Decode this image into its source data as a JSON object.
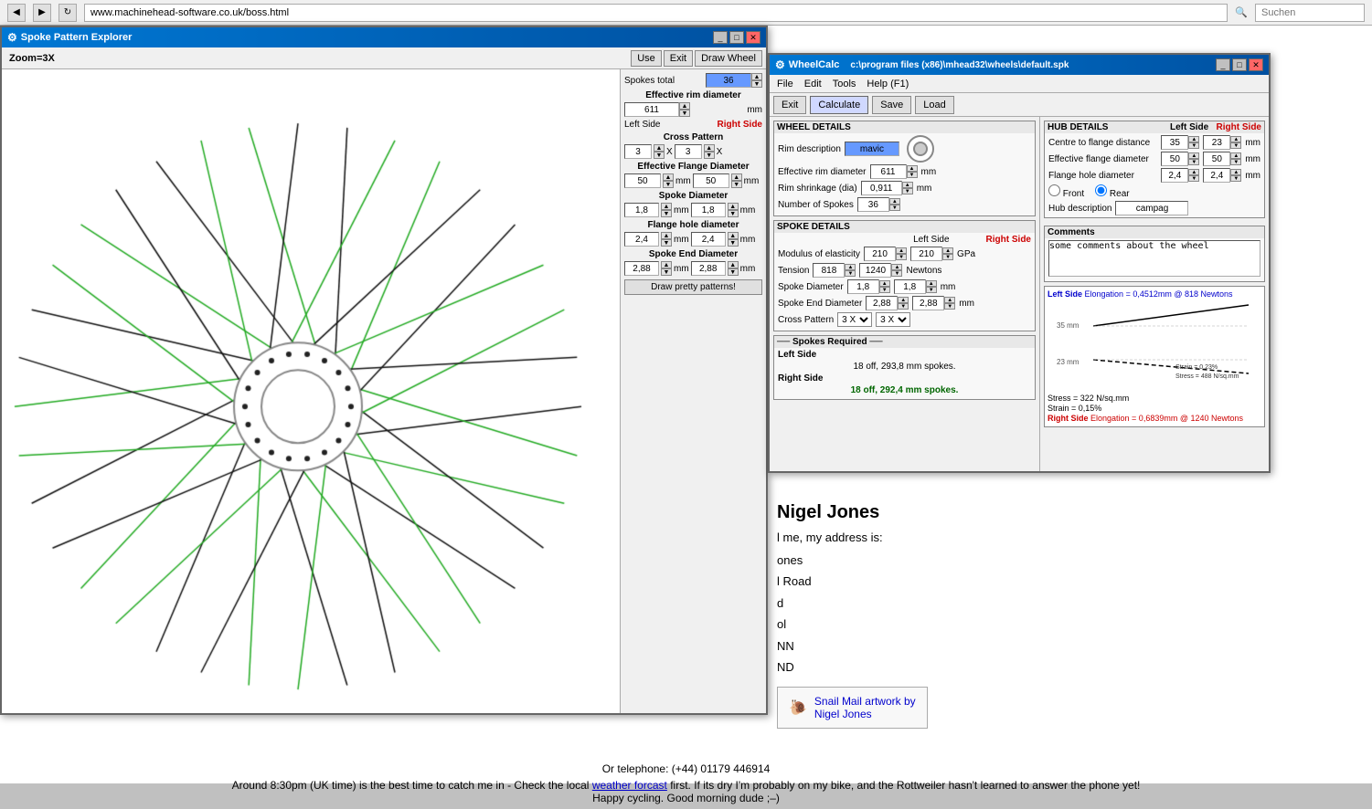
{
  "browser": {
    "url": "www.machinehead-software.co.uk/boss.html",
    "search_placeholder": "Suchen"
  },
  "spe_window": {
    "title": "Spoke Pattern Explorer",
    "zoom": "Zoom=3X",
    "toolbar": {
      "use": "Use",
      "exit": "Exit",
      "draw_wheel": "Draw Wheel"
    },
    "spokes_total_label": "Spokes total",
    "spokes_total_value": "36",
    "eff_rim_dia_label": "Effective rim diameter",
    "eff_rim_dia_value": "611",
    "eff_rim_dia_unit": "mm",
    "left_side": "Left Side",
    "right_side": "Right Side",
    "cross_pattern_label": "Cross Pattern",
    "cross_left": "3",
    "cross_right": "3",
    "eff_flange_dia_label": "Effective Flange Diameter",
    "eff_flange_left": "50",
    "eff_flange_right": "50",
    "flange_unit": "mm",
    "spoke_dia_label": "Spoke Diameter",
    "spoke_dia_left": "1,8",
    "spoke_dia_right": "1,8",
    "spoke_dia_unit": "mm",
    "flange_hole_label": "Flange hole diameter",
    "flange_hole_left": "2,4",
    "flange_hole_right": "2,4",
    "flange_hole_unit": "mm",
    "spoke_end_label": "Spoke End Diameter",
    "spoke_end_left": "2,88",
    "spoke_end_right": "2,88",
    "spoke_end_unit": "mm",
    "draw_patterns_btn": "Draw pretty patterns!"
  },
  "wheelcalc_window": {
    "title": "WheelCalc",
    "path": "c:\\program files (x86)\\mhead32\\wheels\\default.spk",
    "menu": {
      "file": "File",
      "edit": "Edit",
      "tools": "Tools",
      "help": "Help (F1)"
    },
    "toolbar": {
      "exit": "Exit",
      "calculate": "Calculate",
      "save": "Save",
      "load": "Load"
    },
    "wheel_details": {
      "title": "WHEEL DETAILS",
      "rim_desc_label": "Rim description",
      "rim_desc_value": "mavic",
      "eff_rim_dia_label": "Effective rim diameter",
      "eff_rim_dia_value": "611",
      "eff_rim_dia_unit": "mm",
      "rim_shrinkage_label": "Rim shrinkage (dia)",
      "rim_shrinkage_value": "0,911",
      "rim_shrinkage_unit": "mm",
      "num_spokes_label": "Number of Spokes",
      "num_spokes_value": "36"
    },
    "spoke_details": {
      "title": "SPOKE DETAILS",
      "left_side": "Left Side",
      "right_side": "Right Side",
      "modulus_label": "Modulus of elasticity",
      "modulus_left": "210",
      "modulus_right": "210",
      "modulus_unit": "GPa",
      "tension_label": "Tension",
      "tension_left": "818",
      "tension_right": "1240",
      "tension_unit": "Newtons",
      "spoke_dia_label": "Spoke Diameter",
      "spoke_dia_left": "1,8",
      "spoke_dia_right": "1,8",
      "spoke_dia_unit": "mm",
      "spoke_end_label": "Spoke End Diameter",
      "spoke_end_left": "2,88",
      "spoke_end_right": "2,88",
      "spoke_end_unit": "mm",
      "cross_label": "Cross Pattern",
      "cross_left": "3 X",
      "cross_right": "3 X"
    },
    "hub_details": {
      "title": "HUB DETAILS",
      "left_side": "Left Side",
      "right_side": "Right Side",
      "centre_flange_label": "Centre to flange distance",
      "centre_flange_left": "35",
      "centre_flange_right": "23",
      "centre_flange_unit": "mm",
      "eff_flange_label": "Effective flange diameter",
      "eff_flange_left": "50",
      "eff_flange_right": "50",
      "eff_flange_unit": "mm",
      "flange_hole_label": "Flange hole diameter",
      "flange_hole_left": "2,4",
      "flange_hole_right": "2,4",
      "flange_hole_unit": "mm",
      "front_radio": "Front",
      "rear_radio": "Rear",
      "hub_desc_label": "Hub description",
      "hub_desc_value": "campag"
    },
    "comments": {
      "title": "Comments",
      "value": "some comments about the wheel"
    },
    "elongation": {
      "left_label": "Left Side",
      "left_text": "Elongation = 0,4512mm @ 818 Newtons",
      "stress_322": "Stress = 322 N/sq.mm",
      "strain_015": "Strain = 0,15%",
      "right_label": "Right Side",
      "right_text": "Elongation = 0,6839mm @ 1240 Newtons",
      "stress_488": "Stress = 488 N/sq.mm",
      "strain_023": "Strain = 0,23%",
      "dim_35": "35 mm",
      "dim_23": "23 mm"
    },
    "spokes_required": {
      "title": "Spokes Required",
      "left_label": "Left Side",
      "left_value": "18 off, 293,8 mm spokes.",
      "right_label": "Right Side",
      "right_value": "18 off, 292,4 mm spokes."
    }
  },
  "background": {
    "name": "Nigel Jones",
    "text1": "l me, my address is:",
    "address": "ones\nl Road\nd\nol\nNN\nND",
    "snail_label": "Snail Mail artwork by\nNigel Jones",
    "phone": "Or telephone: (+44) 01179 446914",
    "line1": "Around 8:30pm (UK time) is the best time to catch me in - Check the local",
    "link_text": "weather forcast",
    "line2": "first. If its dry I'm probably on my bike, and the Rottweiler hasn't learned to answer the phone yet!",
    "line3": "Happy cycling. Good morning dude ;–)"
  }
}
